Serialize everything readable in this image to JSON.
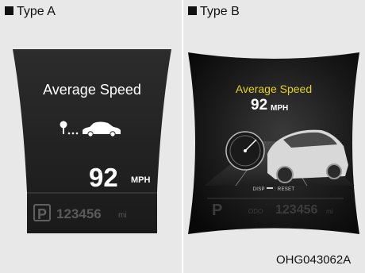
{
  "type_a": {
    "heading": "Type A",
    "title": "Average Speed",
    "speed_value": "92",
    "speed_unit": "MPH",
    "gear": "P",
    "odometer": "123456",
    "odometer_unit": "mi",
    "icon": "distance-to-car-icon"
  },
  "type_b": {
    "heading": "Type B",
    "title": "Average Speed",
    "speed_value": "92",
    "speed_unit": "MPH",
    "hint": "DISP",
    "hint_action": ": RESET",
    "gear": "P",
    "odometer_label": "ODO",
    "odometer": "123456",
    "odometer_unit": "mi",
    "title_color": "#e4d21e"
  },
  "figure_code": "OHG043062A"
}
